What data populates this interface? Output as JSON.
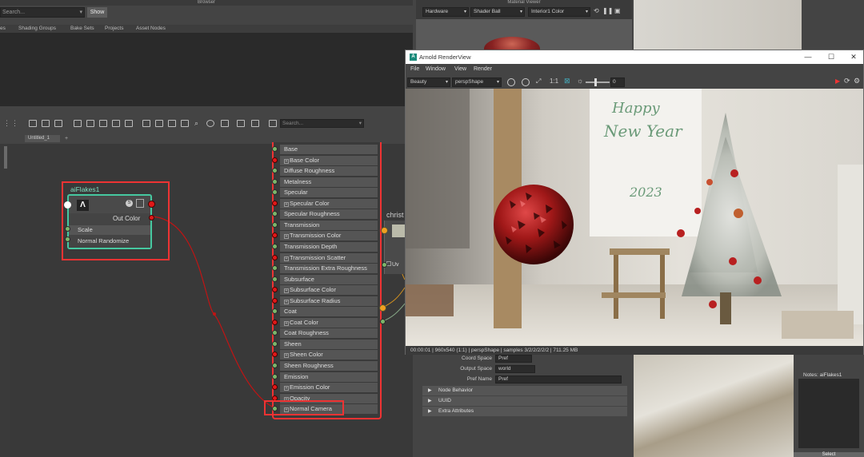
{
  "browser": {
    "title": "Browser",
    "search_placeholder": "Search...",
    "show_label": "Show",
    "tabs": [
      "es",
      "Shading Groups",
      "Bake Sets",
      "Projects",
      "Asset Nodes"
    ]
  },
  "node_editor": {
    "search_placeholder": "Search...",
    "tab_label": "Untitled_1",
    "add_tab": "+",
    "flakes_node": {
      "title": "aiFlakes1",
      "out_label": "Out Color",
      "attrs": [
        "Scale",
        "Normal Randomize"
      ]
    },
    "surface_attrs": [
      {
        "label": "Base",
        "plus": false,
        "port": "green"
      },
      {
        "label": "Base Color",
        "plus": true,
        "port": "red"
      },
      {
        "label": "Diffuse Roughness",
        "plus": false,
        "port": "green"
      },
      {
        "label": "Metalness",
        "plus": false,
        "port": "green"
      },
      {
        "label": "Specular",
        "plus": false,
        "port": "green"
      },
      {
        "label": "Specular Color",
        "plus": true,
        "port": "red"
      },
      {
        "label": "Specular Roughness",
        "plus": false,
        "port": "green"
      },
      {
        "label": "Transmission",
        "plus": false,
        "port": "green"
      },
      {
        "label": "Transmission Color",
        "plus": true,
        "port": "red"
      },
      {
        "label": "Transmission Depth",
        "plus": false,
        "port": "green"
      },
      {
        "label": "Transmission Scatter",
        "plus": true,
        "port": "red"
      },
      {
        "label": "Transmission Extra Roughness",
        "plus": false,
        "port": "green"
      },
      {
        "label": "Subsurface",
        "plus": false,
        "port": "green"
      },
      {
        "label": "Subsurface Color",
        "plus": true,
        "port": "red"
      },
      {
        "label": "Subsurface Radius",
        "plus": true,
        "port": "red"
      },
      {
        "label": "Coat",
        "plus": false,
        "port": "green"
      },
      {
        "label": "Coat Color",
        "plus": true,
        "port": "red"
      },
      {
        "label": "Coat Roughness",
        "plus": false,
        "port": "green"
      },
      {
        "label": "Sheen",
        "plus": false,
        "port": "green"
      },
      {
        "label": "Sheen Color",
        "plus": true,
        "port": "red"
      },
      {
        "label": "Sheen Roughness",
        "plus": false,
        "port": "green"
      },
      {
        "label": "Emission",
        "plus": false,
        "port": "green"
      },
      {
        "label": "Emission Color",
        "plus": true,
        "port": "red"
      },
      {
        "label": "Opacity",
        "plus": true,
        "port": "red"
      },
      {
        "label": "Normal Camera",
        "plus": true,
        "port": "green"
      }
    ],
    "christ_node": {
      "title": "christ",
      "uv_label": "Uv"
    }
  },
  "material_viewer": {
    "title": "Material Viewer",
    "renderer": "Hardware",
    "shape": "Shader Ball",
    "env": "Interior1 Color"
  },
  "render_view": {
    "title": "Arnold RenderView",
    "icon": "A",
    "menu": [
      "File",
      "Window",
      "View",
      "Render"
    ],
    "aov": "Beauty",
    "camera": "perspShape",
    "ratio_label": "1:1",
    "exposure": "0",
    "status": "00:00:01 | 960x540 (1:1) | perspShape | samples 3/2/2/2/2/2 | 711.25 MB",
    "scene_text": [
      "Happy",
      "New Year",
      "2023"
    ]
  },
  "attribute_editor": {
    "coord_space_label": "Coord Space",
    "coord_space_value": "Pref",
    "output_space_label": "Output Space",
    "output_space_value": "world",
    "pref_name_label": "Pref Name",
    "pref_name_value": "Pref",
    "sections": [
      "Node Behavior",
      "UUID",
      "Extra Attributes"
    ]
  },
  "notes": {
    "label": "Notes:  aiFlakes1",
    "select_label": "Select"
  },
  "colors": {
    "accent_teal": "#46c8a0",
    "highlight_red": "#e33333",
    "port_red": "#e01818",
    "port_green": "#7cb66a"
  }
}
